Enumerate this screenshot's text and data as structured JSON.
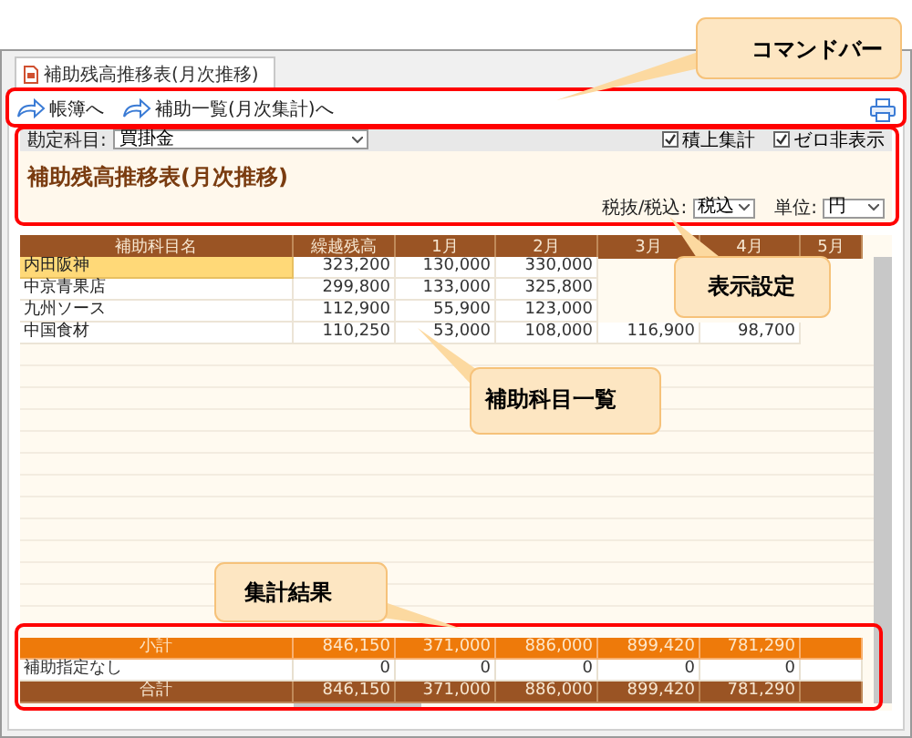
{
  "tab": {
    "label": "補助残高推移表(月次推移)",
    "selected": true
  },
  "command_bar": {
    "links": [
      "帳簿へ",
      "補助一覧(月次集計)へ"
    ]
  },
  "settings": {
    "account_label": "勘定科目:",
    "account_value": "買掛金",
    "checkboxes": [
      {
        "label": "積上集計",
        "checked": true
      },
      {
        "label": "ゼロ非表示",
        "checked": true
      }
    ],
    "title": "補助残高推移表(月次推移)",
    "tax_label": "税抜/税込:",
    "tax_value": "税込",
    "unit_label": "単位:",
    "unit_value": "円"
  },
  "table": {
    "columns": [
      "補助科目名",
      "繰越残高",
      "1月",
      "2月",
      "3月",
      "4月",
      "5月"
    ],
    "rows": [
      {
        "name": "内田阪神",
        "selected": true,
        "values": [
          "323,200",
          "130,000",
          "330,000"
        ]
      },
      {
        "name": "中京青果店",
        "selected": false,
        "values": [
          "299,800",
          "133,000",
          "325,800"
        ]
      },
      {
        "name": "九州ソース",
        "selected": false,
        "values": [
          "112,900",
          "55,900",
          "123,000"
        ]
      },
      {
        "name": "中国食材",
        "selected": false,
        "values": [
          "110,250",
          "53,000",
          "108,000",
          "116,900",
          "98,700"
        ]
      }
    ],
    "summary": [
      {
        "kind": "subtotal",
        "name": "小計",
        "values": [
          "846,150",
          "371,000",
          "886,000",
          "899,420",
          "781,290"
        ]
      },
      {
        "kind": "plain",
        "name": "補助指定なし",
        "values": [
          "0",
          "0",
          "0",
          "0",
          "0"
        ]
      },
      {
        "kind": "total",
        "name": "合計",
        "values": [
          "846,150",
          "371,000",
          "886,000",
          "899,420",
          "781,290"
        ]
      }
    ]
  },
  "callouts": [
    {
      "label": "コマンドバー"
    },
    {
      "label": "表示設定"
    },
    {
      "label": "補助科目一覧"
    },
    {
      "label": "集計結果"
    }
  ]
}
